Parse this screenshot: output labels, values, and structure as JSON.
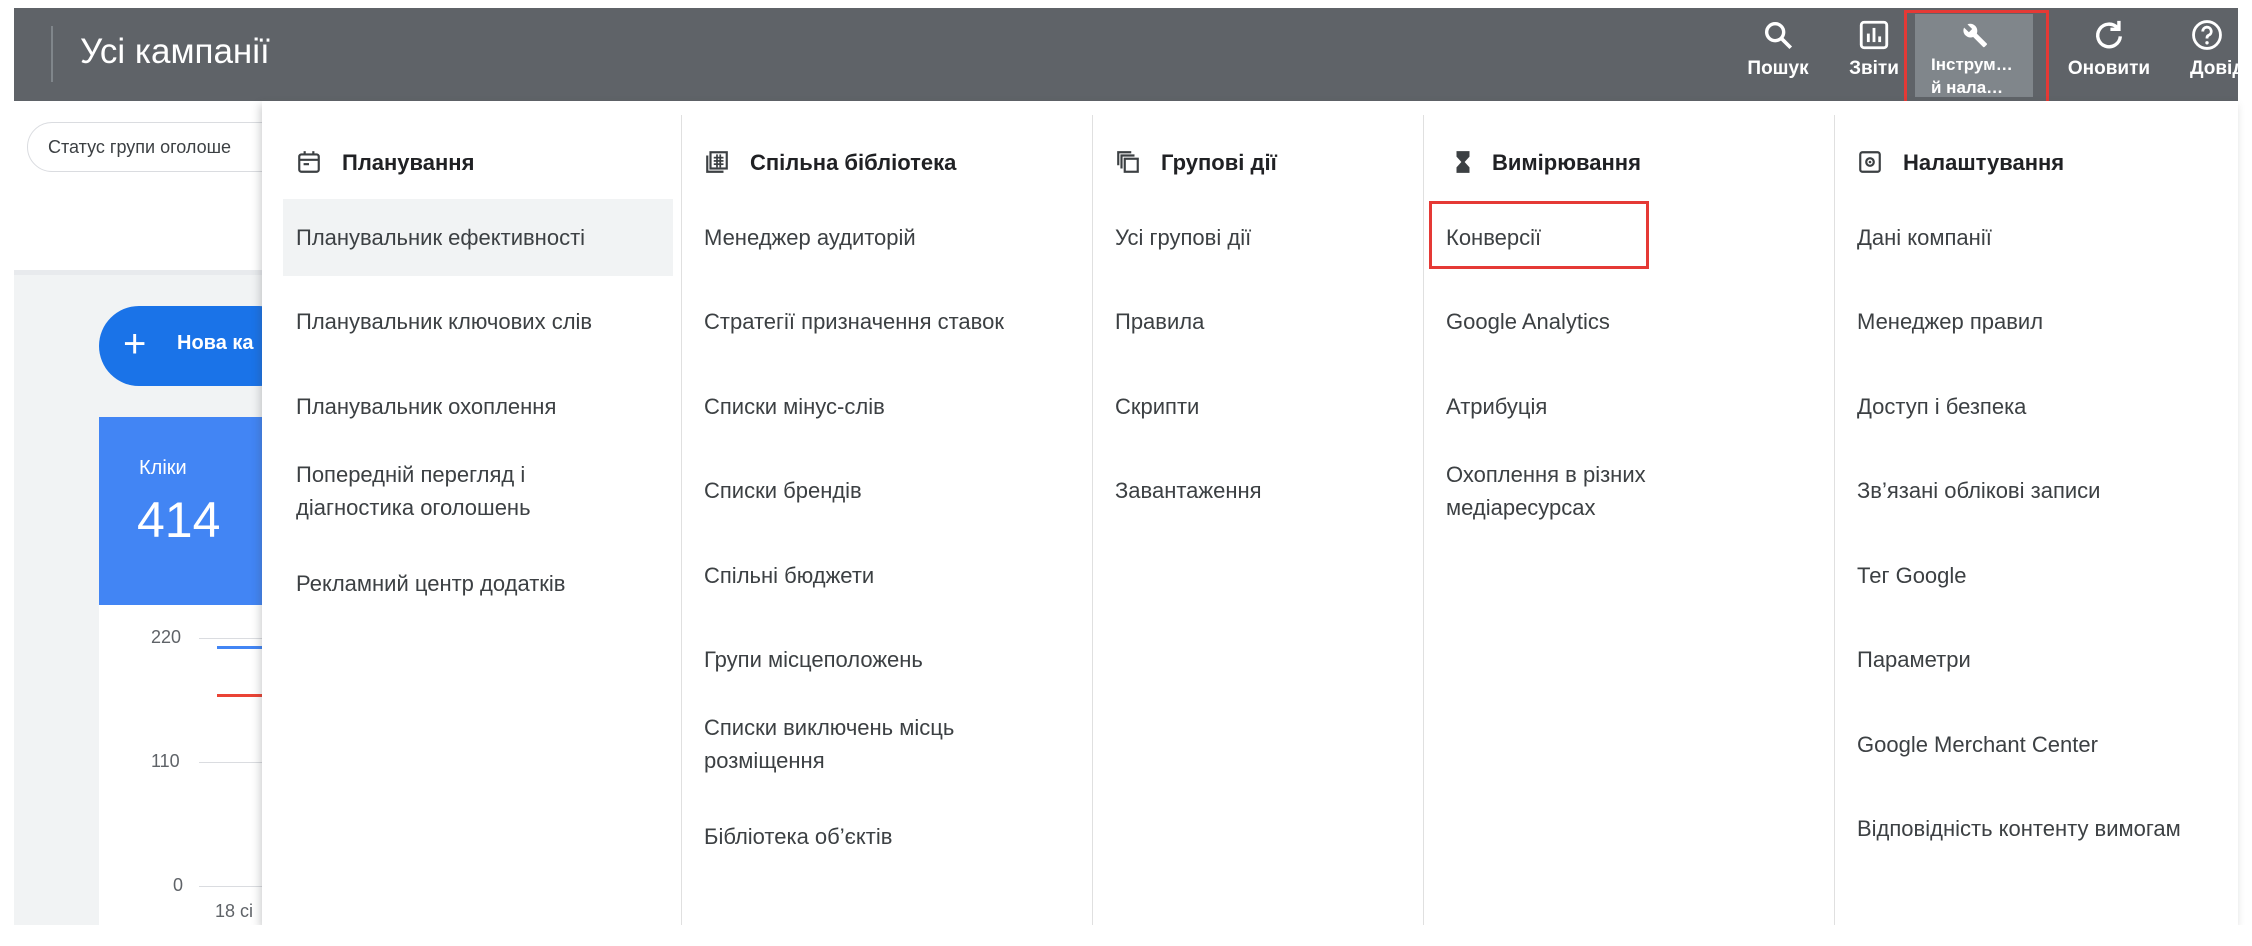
{
  "header": {
    "title": "Усі кампанії",
    "tools": [
      {
        "icon": "search-icon",
        "label": "Пошук"
      },
      {
        "icon": "reports-icon",
        "label": "Звіти"
      },
      {
        "icon": "wrench-icon",
        "label_line1": "Інструм…",
        "label_line2": "й нала…",
        "active": true
      },
      {
        "icon": "refresh-icon",
        "label": "Оновити"
      },
      {
        "icon": "help-icon",
        "label": "Довід"
      }
    ]
  },
  "background": {
    "filter_chip": "Статус групи оголоше",
    "new_button": "Нова ка",
    "card_metric_label": "Кліки",
    "card_metric_value": "414",
    "chart_ticks": [
      "220",
      "110",
      "0"
    ],
    "x_label": "18 сі"
  },
  "menu": {
    "columns": [
      {
        "icon": "calendar-icon",
        "title": "Планування",
        "items": [
          "Планувальник ефективності",
          "Планувальник ключових слів",
          "Планувальник охоплення",
          "Попередній перегляд і\nдіагностика оголошень",
          "Рекламний центр додатків"
        ]
      },
      {
        "icon": "library-icon",
        "title": "Спільна бібліотека",
        "items": [
          "Менеджер аудиторій",
          "Стратегії призначення ставок",
          "Списки мінус-слів",
          "Списки брендів",
          "Спільні бюджети",
          "Групи місцеположень",
          "Списки виключень місць\nрозміщення",
          "Бібліотека об’єктів"
        ]
      },
      {
        "icon": "bulk-actions-icon",
        "title": "Групові дії",
        "items": [
          "Усі групові дії",
          "Правила",
          "Скрипти",
          "Завантаження"
        ]
      },
      {
        "icon": "hourglass-icon",
        "title": "Вимірювання",
        "items": [
          "Конверсії",
          "Google Analytics",
          "Атрибуція",
          "Охоплення в різних\nмедіаресурсах"
        ]
      },
      {
        "icon": "settings-icon",
        "title": "Налаштування",
        "items": [
          "Дані компанії",
          "Менеджер правил",
          "Доступ і безпека",
          "Зв’язані облікові записи",
          "Тег Google",
          "Параметри",
          "Google Merchant Center",
          "Відповідність контенту вимогам"
        ]
      }
    ]
  },
  "colors": {
    "header_bg": "#5f6368",
    "highlight_box": "#e53935",
    "primary": "#1a73e8"
  }
}
